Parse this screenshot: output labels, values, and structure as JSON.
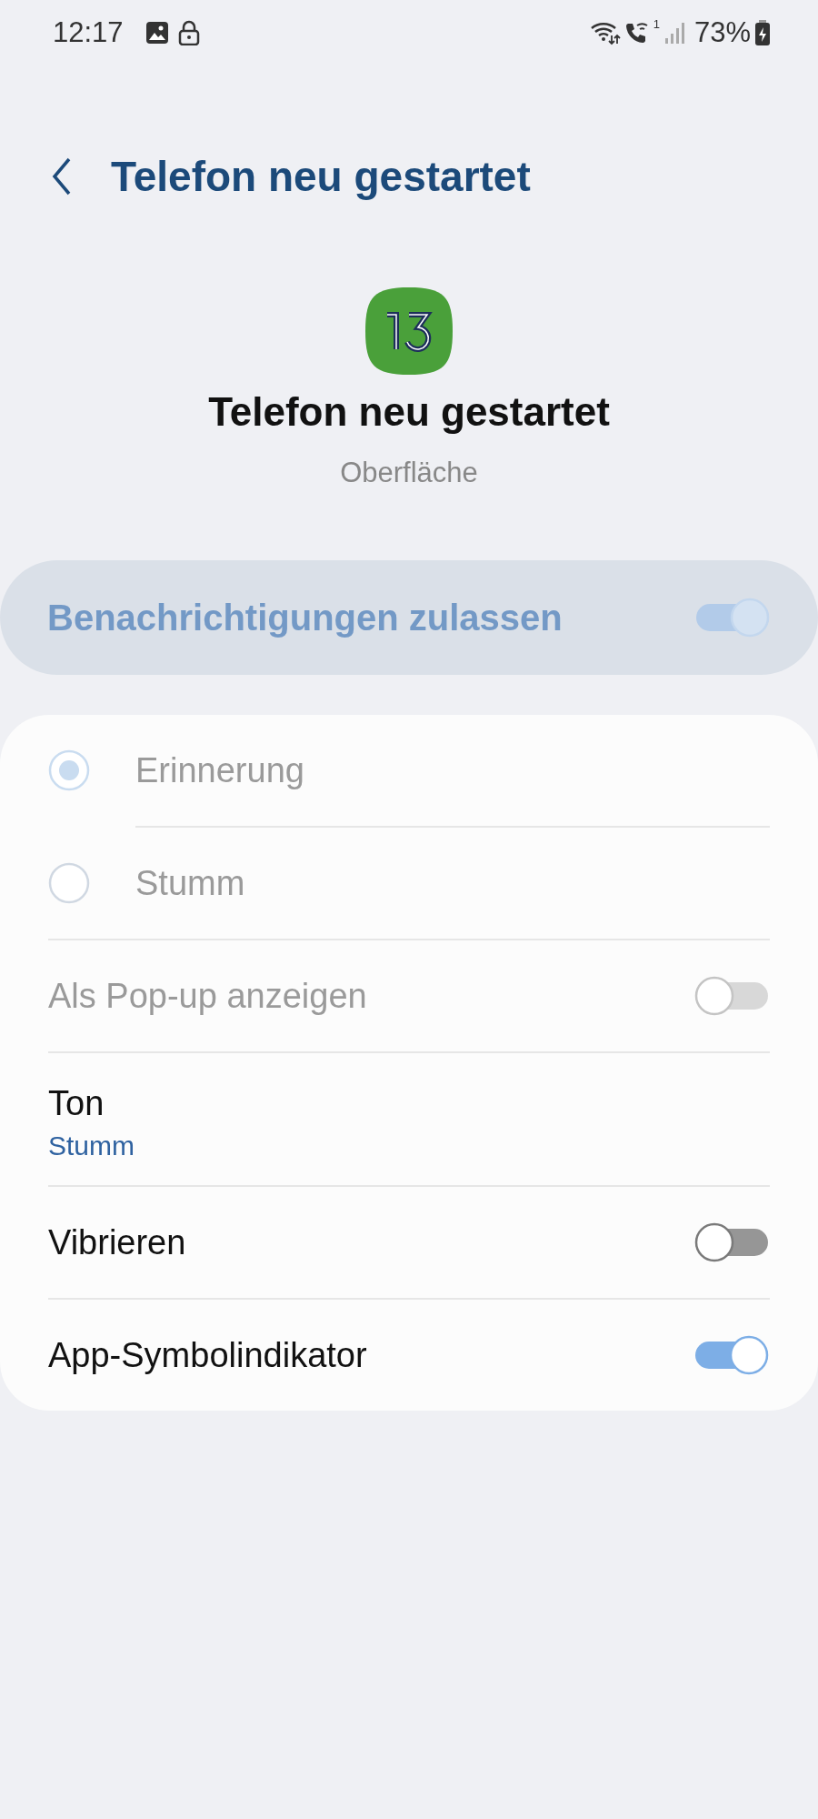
{
  "status_bar": {
    "time": "12:17",
    "sim_label": "1",
    "battery": "73%"
  },
  "header": {
    "title": "Telefon neu gestartet"
  },
  "app": {
    "title": "Telefon neu gestartet",
    "subtitle": "Oberfläche"
  },
  "master_switch": {
    "label": "Benachrichtigungen zulassen",
    "on": true,
    "disabled": true
  },
  "settings": [
    {
      "kind": "radio",
      "label": "Erinnerung",
      "selected": true,
      "disabled": true
    },
    {
      "kind": "radio",
      "label": "Stumm",
      "selected": false,
      "disabled": true
    },
    {
      "kind": "toggle",
      "label": "Als Pop-up anzeigen",
      "on": false,
      "disabled": true
    },
    {
      "kind": "value",
      "label": "Ton",
      "value": "Stumm"
    },
    {
      "kind": "toggle",
      "label": "Vibrieren",
      "on": false,
      "disabled": false
    },
    {
      "kind": "toggle",
      "label": "App-Symbolindikator",
      "on": true,
      "disabled": false
    }
  ]
}
